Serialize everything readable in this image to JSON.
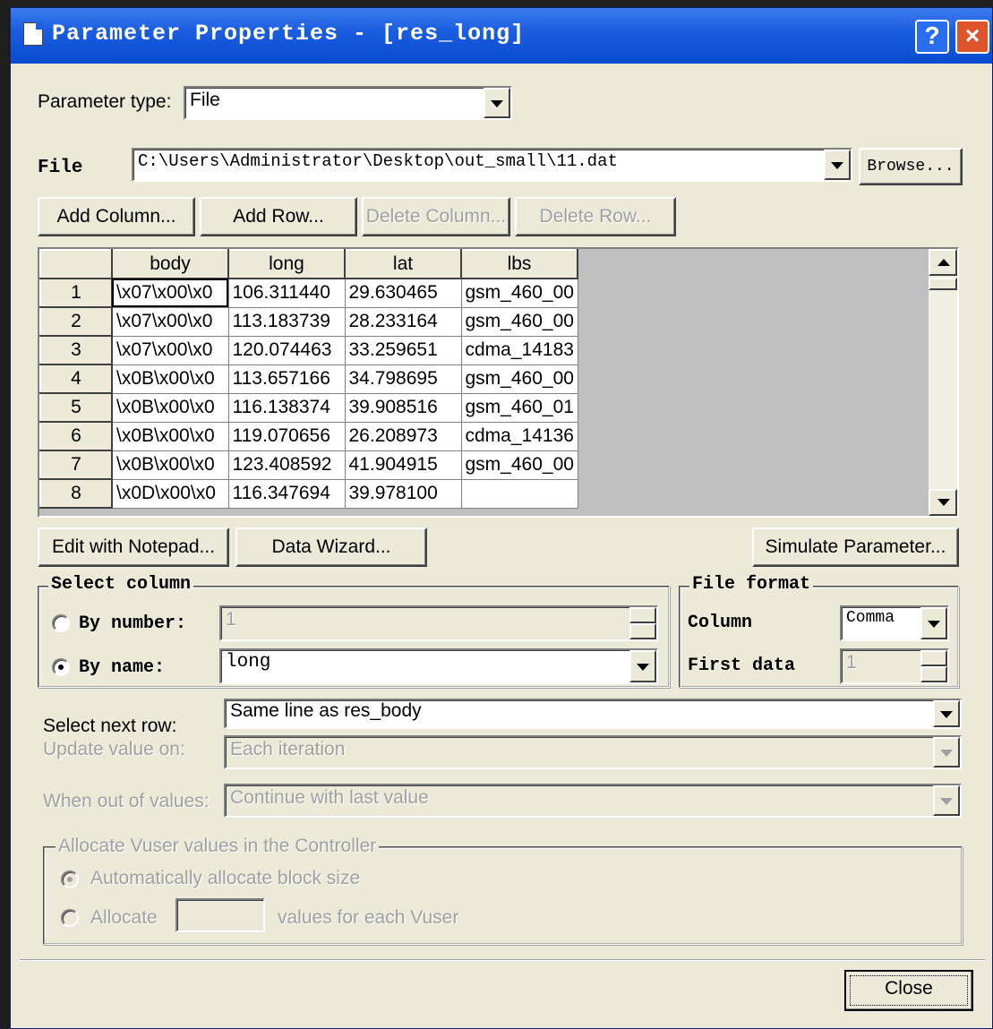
{
  "window": {
    "title": "Parameter Properties - [res_long]",
    "help_label": "?",
    "close_label": "×"
  },
  "parameter_type": {
    "label": "Parameter type:",
    "value": "File"
  },
  "file": {
    "label": "File",
    "path": "C:\\Users\\Administrator\\Desktop\\out_small\\11.dat",
    "browse_label": "Browse..."
  },
  "grid_buttons": {
    "add_column": "Add Column...",
    "add_row": "Add Row...",
    "delete_column": "Delete Column...",
    "delete_row": "Delete Row..."
  },
  "table": {
    "columns": [
      "body",
      "long",
      "lat",
      "lbs"
    ],
    "rows": [
      {
        "n": "1",
        "body": "\\x07\\x00\\x0",
        "long": "106.311440",
        "lat": "29.630465",
        "lbs": "gsm_460_00"
      },
      {
        "n": "2",
        "body": "\\x07\\x00\\x0",
        "long": "113.183739",
        "lat": "28.233164",
        "lbs": "gsm_460_00"
      },
      {
        "n": "3",
        "body": "\\x07\\x00\\x0",
        "long": "120.074463",
        "lat": "33.259651",
        "lbs": "cdma_14183"
      },
      {
        "n": "4",
        "body": "\\x0B\\x00\\x0",
        "long": "113.657166",
        "lat": "34.798695",
        "lbs": "gsm_460_00"
      },
      {
        "n": "5",
        "body": "\\x0B\\x00\\x0",
        "long": "116.138374",
        "lat": "39.908516",
        "lbs": "gsm_460_01"
      },
      {
        "n": "6",
        "body": "\\x0B\\x00\\x0",
        "long": "119.070656",
        "lat": "26.208973",
        "lbs": "cdma_14136"
      },
      {
        "n": "7",
        "body": "\\x0B\\x00\\x0",
        "long": "123.408592",
        "lat": "41.904915",
        "lbs": "gsm_460_00"
      },
      {
        "n": "8",
        "body": "\\x0D\\x00\\x0",
        "long": "116.347694",
        "lat": "39.978100",
        "lbs": ""
      }
    ]
  },
  "action_buttons": {
    "edit_notepad": "Edit with Notepad...",
    "data_wizard": "Data Wizard...",
    "simulate": "Simulate Parameter..."
  },
  "select_column": {
    "title": "Select column",
    "by_number_label": "By number:",
    "by_number_value": "1",
    "by_name_label": "By name:",
    "by_name_value": "long"
  },
  "file_format": {
    "title": "File format",
    "column_label": "Column",
    "column_value": "Comma",
    "first_data_label": "First data",
    "first_data_value": "1"
  },
  "settings": {
    "select_next_row_label": "Select next row:",
    "select_next_row_value": "Same line as res_body",
    "update_value_label": "Update value on:",
    "update_value_value": "Each iteration",
    "out_of_values_label": "When out of values:",
    "out_of_values_value": "Continue with last value"
  },
  "allocate": {
    "title": "Allocate Vuser values in the Controller",
    "auto_label": "Automatically allocate block size",
    "allocate_label": "Allocate",
    "values_label": "values for each Vuser"
  },
  "close_button": "Close"
}
